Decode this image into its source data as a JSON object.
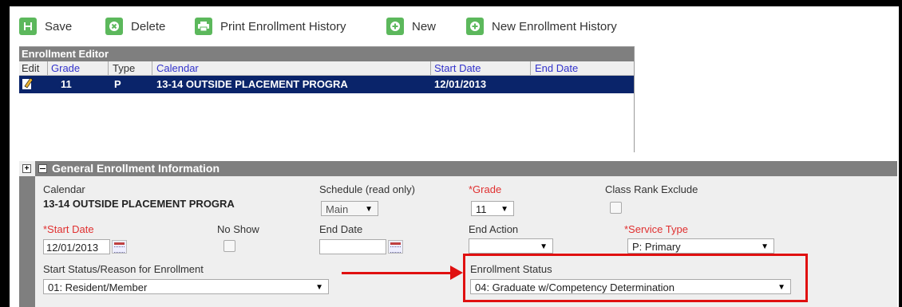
{
  "toolbar": {
    "save": "Save",
    "delete": "Delete",
    "print": "Print Enrollment History",
    "new": "New",
    "new_history": "New Enrollment History"
  },
  "editor": {
    "title": "Enrollment Editor",
    "columns": {
      "edit": "Edit",
      "grade": "Grade",
      "type": "Type",
      "calendar": "Calendar",
      "start_date": "Start Date",
      "end_date": "End Date"
    },
    "row": {
      "grade": "11",
      "type": "P",
      "calendar": "13-14 OUTSIDE PLACEMENT PROGRA",
      "start_date": "12/01/2013",
      "end_date": ""
    }
  },
  "general": {
    "title": "General Enrollment Information",
    "calendar_label": "Calendar",
    "calendar_value": "13-14 OUTSIDE PLACEMENT PROGRA",
    "schedule_label": "Schedule (read only)",
    "schedule_value": "Main",
    "grade_label": "*Grade",
    "grade_value": "11",
    "class_rank_label": "Class Rank Exclude",
    "start_date_label": "*Start Date",
    "start_date_value": "12/01/2013",
    "no_show_label": "No Show",
    "end_date_label": "End Date",
    "end_date_value": "",
    "end_action_label": "End Action",
    "end_action_value": "",
    "service_type_label": "*Service Type",
    "service_type_value": "P: Primary",
    "start_status_label": "Start Status/Reason for Enrollment",
    "start_status_value": "01: Resident/Member",
    "enrollment_status_label": "Enrollment Status",
    "enrollment_status_value": "04: Graduate w/Competency Determination"
  },
  "colors": {
    "accent_green": "#5cb85c",
    "selection": "#0a246a",
    "header_gray": "#7f7f7f",
    "highlight": "#e01010"
  }
}
